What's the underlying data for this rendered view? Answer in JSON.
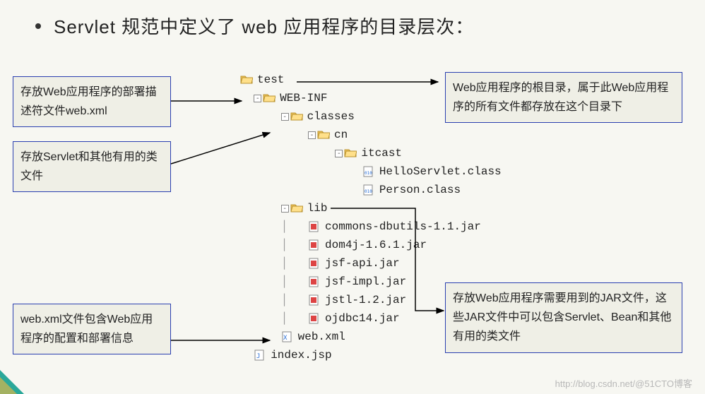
{
  "title": "Servlet 规范中定义了 web 应用程序的目录层次：",
  "callouts": {
    "c1": "存放Web应用程序的部署描述符文件web.xml",
    "c2": "存放Servlet和其他有用的类文件",
    "c3": "web.xml文件包含Web应用程序的配置和部署信息",
    "c4": "Web应用程序的根目录，属于此Web应用程序的所有文件都存放在这个目录下",
    "c5": "存放Web应用程序需要用到的JAR文件，这些JAR文件中可以包含Servlet、Bean和其他有用的类文件"
  },
  "tree": {
    "test": "test",
    "webinf": "WEB-INF",
    "classes": "classes",
    "cn": "cn",
    "itcast": "itcast",
    "hello": "HelloServlet.class",
    "person": "Person.class",
    "lib": "lib",
    "jar1": "commons-dbutils-1.1.jar",
    "jar2": "dom4j-1.6.1.jar",
    "jar3": "jsf-api.jar",
    "jar4": "jsf-impl.jar",
    "jar5": "jstl-1.2.jar",
    "jar6": "ojdbc14.jar",
    "webxml": "web.xml",
    "index": "index.jsp"
  },
  "watermark": "http://blog.csdn.net/@51CTO博客"
}
